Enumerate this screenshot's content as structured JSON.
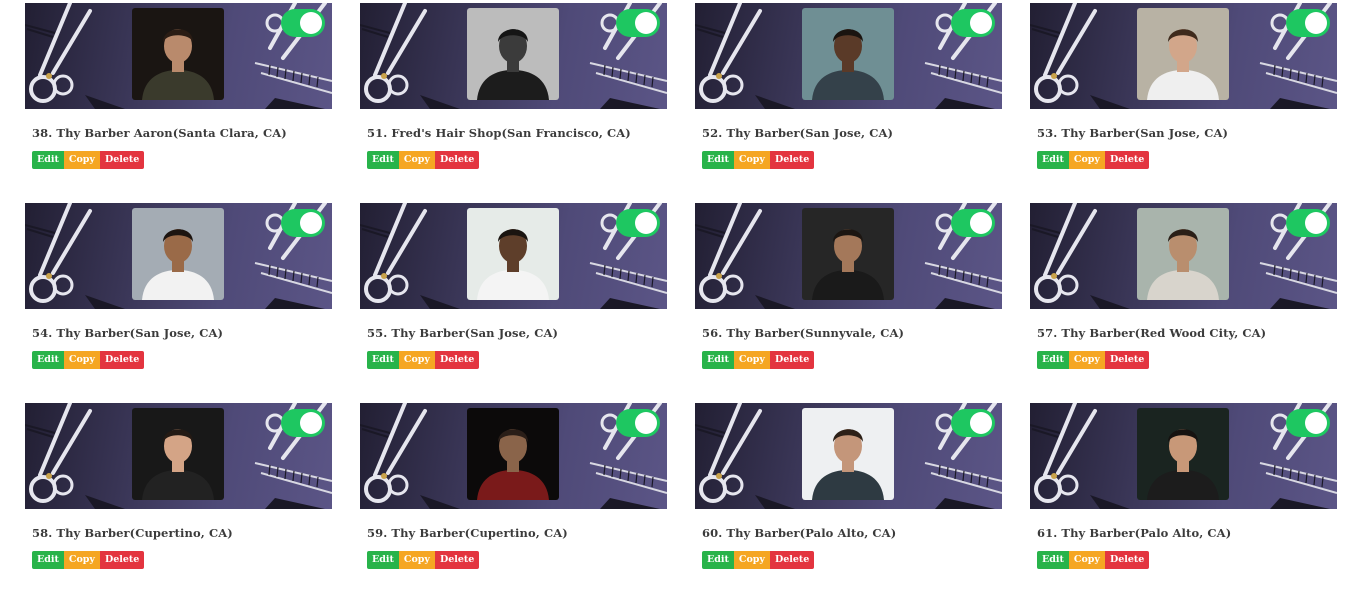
{
  "actions": {
    "edit_label": "Edit",
    "copy_label": "Copy",
    "delete_label": "Delete"
  },
  "colors": {
    "toggle_on": "#1ec761",
    "edit": "#28b34a",
    "copy": "#f5a623",
    "delete": "#e3343f",
    "banner": "#3a3657"
  },
  "barbers": [
    {
      "title": "38. Thy Barber Aaron(Santa Clara, CA)",
      "enabled": true,
      "photo": {
        "bg": "#1a1512",
        "shirt": "#3a3a2c",
        "skin": "#b98a6c",
        "hair": "#2a1c14"
      }
    },
    {
      "title": "51. Fred's Hair Shop(San Francisco, CA)",
      "enabled": true,
      "photo": {
        "bg": "#bcbcbc",
        "shirt": "#1c1c1c",
        "skin": "#3b3b3b",
        "hair": "#151515"
      }
    },
    {
      "title": "52. Thy Barber(San Jose, CA)",
      "enabled": true,
      "photo": {
        "bg": "#6f8f94",
        "shirt": "#34414a",
        "skin": "#5a3a28",
        "hair": "#1a1410"
      }
    },
    {
      "title": "53. Thy Barber(San Jose, CA)",
      "enabled": true,
      "photo": {
        "bg": "#b8b2a4",
        "shirt": "#efefef",
        "skin": "#d2a68a",
        "hair": "#3e2a1c"
      }
    },
    {
      "title": "54. Thy Barber(San Jose, CA)",
      "enabled": true,
      "photo": {
        "bg": "#a4acb4",
        "shirt": "#f2f2f2",
        "skin": "#9a6a48",
        "hair": "#1c1410"
      }
    },
    {
      "title": "55. Thy Barber(San Jose, CA)",
      "enabled": true,
      "photo": {
        "bg": "#e6ebe8",
        "shirt": "#f4f4f4",
        "skin": "#5e3e2a",
        "hair": "#1a1410"
      }
    },
    {
      "title": "56. Thy Barber(Sunnyvale, CA)",
      "enabled": true,
      "photo": {
        "bg": "#262626",
        "shirt": "#1a1a1a",
        "skin": "#a4785a",
        "hair": "#1c1612"
      }
    },
    {
      "title": "57. Thy Barber(Red Wood City, CA)",
      "enabled": true,
      "photo": {
        "bg": "#a9b4ac",
        "shirt": "#d8d4cc",
        "skin": "#b98e6e",
        "hair": "#2a1f17"
      }
    },
    {
      "title": "58. Thy Barber(Cupertino, CA)",
      "enabled": true,
      "photo": {
        "bg": "#181818",
        "shirt": "#222222",
        "skin": "#d4a486",
        "hair": "#241a14"
      }
    },
    {
      "title": "59. Thy Barber(Cupertino, CA)",
      "enabled": true,
      "photo": {
        "bg": "#0c0a0a",
        "shirt": "#7a1a1a",
        "skin": "#8a644a",
        "hair": "#2a1e18"
      }
    },
    {
      "title": "60. Thy Barber(Palo Alto, CA)",
      "enabled": true,
      "photo": {
        "bg": "#eef0f2",
        "shirt": "#2e3a42",
        "skin": "#c4967a",
        "hair": "#2c2018"
      }
    },
    {
      "title": "61. Thy Barber(Palo Alto, CA)",
      "enabled": true,
      "photo": {
        "bg": "#1a2420",
        "shirt": "#1c1c1c",
        "skin": "#c89878",
        "hair": "#161210"
      }
    }
  ]
}
